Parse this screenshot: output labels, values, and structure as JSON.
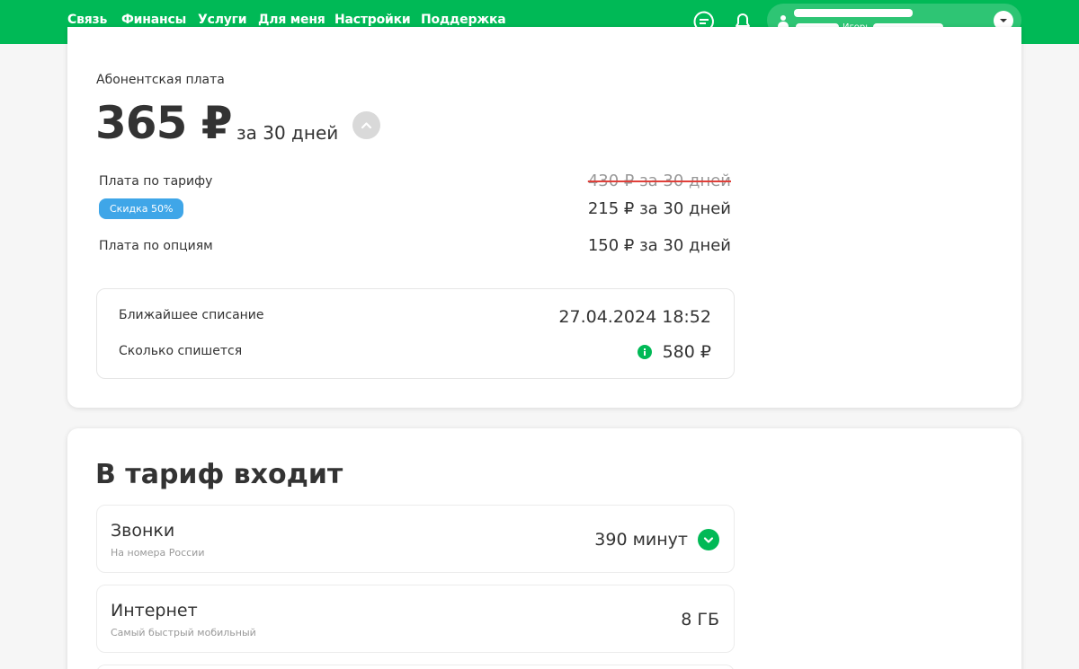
{
  "nav": {
    "items": [
      {
        "label": "Связь"
      },
      {
        "label": "Финансы"
      },
      {
        "label": "Услуги"
      },
      {
        "label": "Для меня"
      },
      {
        "label": "Настройки"
      },
      {
        "label": "Поддержка"
      }
    ]
  },
  "header": {
    "icons": [
      "chat-icon",
      "bell-icon"
    ],
    "user": {
      "name_visible": "Игорь"
    }
  },
  "fee": {
    "label": "Абонентская плата",
    "amount": "365 ₽",
    "period": "за 30 дней",
    "tariff_label": "Плата по тарифу",
    "tariff_old": "430 ₽ за 30 дней",
    "tariff_new": "215 ₽ за 30 дней",
    "discount_badge": "Скидка 50%",
    "options_label": "Плата по опциям",
    "options_value": "150 ₽ за 30 дней"
  },
  "charge": {
    "next_label": "Ближайшее списание",
    "next_value": "27.04.2024 18:52",
    "amount_label": "Сколько спишется",
    "amount_value": "580 ₽"
  },
  "included": {
    "title": "В тариф входит",
    "items": [
      {
        "title": "Звонки",
        "subtitle": "На номера России",
        "value": "390 минут"
      },
      {
        "title": "Интернет",
        "subtitle": "Самый быстрый мобильный",
        "value": "8 ГБ"
      }
    ]
  },
  "colors": {
    "brand": "#00b956",
    "badge": "#3fa6e8",
    "strike": "#e0403a"
  }
}
